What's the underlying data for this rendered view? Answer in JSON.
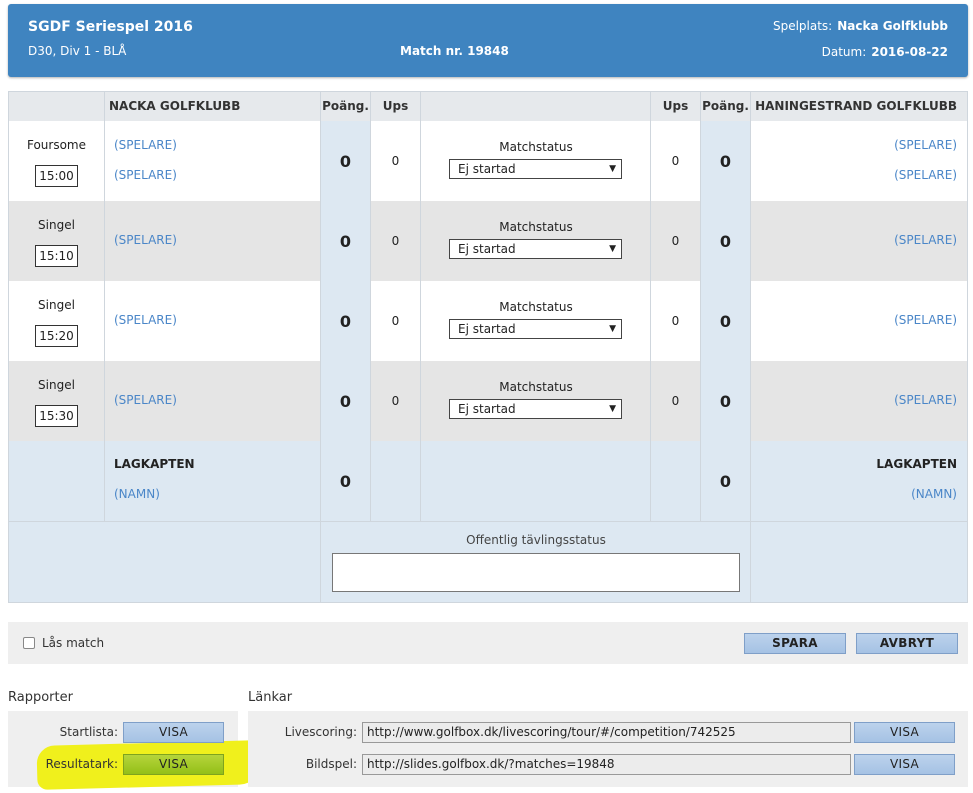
{
  "header": {
    "title": "SGDF Seriespel 2016",
    "division": "D30, Div 1 - BLÅ",
    "match": "Match nr. 19848",
    "venue_label": "Spelplats:",
    "venue": "Nacka Golfklubb",
    "date_label": "Datum:",
    "date": "2016-08-22",
    "color": "#3f84c0"
  },
  "table": {
    "home_team": "NACKA GOLFKLUBB",
    "away_team": "HANINGESTRAND GOLFKLUBB",
    "points_header": "Poäng.",
    "ups_header": "Ups",
    "matches": [
      {
        "type": "Foursome",
        "time": "15:00",
        "home_players": [
          "(SPELARE)",
          "(SPELARE)"
        ],
        "home_points": "0",
        "home_ups": "0",
        "status_label": "Matchstatus",
        "status": "Ej startad",
        "away_ups": "0",
        "away_points": "0",
        "away_players": [
          "(SPELARE)",
          "(SPELARE)"
        ]
      },
      {
        "type": "Singel",
        "time": "15:10",
        "home_players": [
          "(SPELARE)"
        ],
        "home_points": "0",
        "home_ups": "0",
        "status_label": "Matchstatus",
        "status": "Ej startad",
        "away_ups": "0",
        "away_points": "0",
        "away_players": [
          "(SPELARE)"
        ]
      },
      {
        "type": "Singel",
        "time": "15:20",
        "home_players": [
          "(SPELARE)"
        ],
        "home_points": "0",
        "home_ups": "0",
        "status_label": "Matchstatus",
        "status": "Ej startad",
        "away_ups": "0",
        "away_points": "0",
        "away_players": [
          "(SPELARE)"
        ]
      },
      {
        "type": "Singel",
        "time": "15:30",
        "home_players": [
          "(SPELARE)"
        ],
        "home_points": "0",
        "home_ups": "0",
        "status_label": "Matchstatus",
        "status": "Ej startad",
        "away_ups": "0",
        "away_points": "0",
        "away_players": [
          "(SPELARE)"
        ]
      }
    ],
    "captain": {
      "label": "LAGKAPTEN",
      "home_name": "(NAMN)",
      "away_name": "(NAMN)",
      "home_points": "0",
      "away_points": "0"
    },
    "public_status_label": "Offentlig tävlingsstatus",
    "public_status_value": ""
  },
  "actions": {
    "lock_label": "Lås match",
    "save": "SPARA",
    "cancel": "AVBRYT"
  },
  "reports": {
    "title": "Rapporter",
    "startlist_label": "Startlista:",
    "startlist_button": "VISA",
    "result_label": "Resultatark:",
    "result_button": "VISA"
  },
  "links": {
    "title": "Länkar",
    "livescoring_label": "Livescoring:",
    "livescoring_url": "http://www.golfbox.dk/livescoring/tour/#/competition/742525",
    "livescoring_button": "VISA",
    "slideshow_label": "Bildspel:",
    "slideshow_url": "http://slides.golfbox.dk/?matches=19848",
    "slideshow_button": "VISA"
  }
}
